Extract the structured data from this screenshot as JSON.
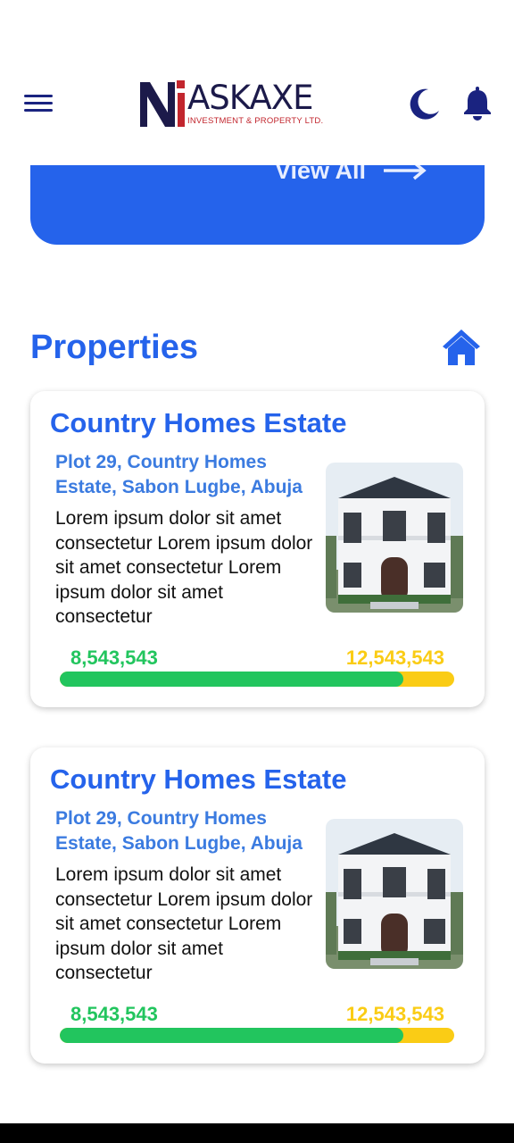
{
  "header": {
    "brand_name": "ASKAXE",
    "brand_sub": "INVESTMENT & PROPERTY LTD.",
    "logo_letters": "NI",
    "menu_icon": "hamburger-menu-icon",
    "theme_icon": "moon-icon",
    "notification_icon": "bell-icon"
  },
  "banner": {
    "view_all_label": "View All",
    "arrow_icon": "arrow-right-icon",
    "color": "#2563eb"
  },
  "properties": {
    "title": "Properties",
    "icon": "home-icon",
    "items": [
      {
        "title": "Country Homes Estate",
        "address": "Plot 29, Country Homes Estate, Sabon Lugbe, Abuja",
        "description": "Lorem ipsum dolor sit amet consectetur Lorem ipsum dolor sit amet consectetur Lorem ipsum dolor sit amet consectetur",
        "raised": "8,543,543",
        "target": "12,543,543",
        "progress_fraction": 0.87
      },
      {
        "title": "Country Homes Estate",
        "address": "Plot 29, Country Homes Estate, Sabon Lugbe, Abuja",
        "description": "Lorem ipsum dolor sit amet consectetur Lorem ipsum dolor sit amet consectetur Lorem ipsum dolor sit amet consectetur",
        "raised": "8,543,543",
        "target": "12,543,543",
        "progress_fraction": 0.87
      }
    ]
  },
  "colors": {
    "accent": "#2563eb",
    "raised": "#22c55e",
    "target": "#facc15",
    "nav": "#1a2380"
  }
}
